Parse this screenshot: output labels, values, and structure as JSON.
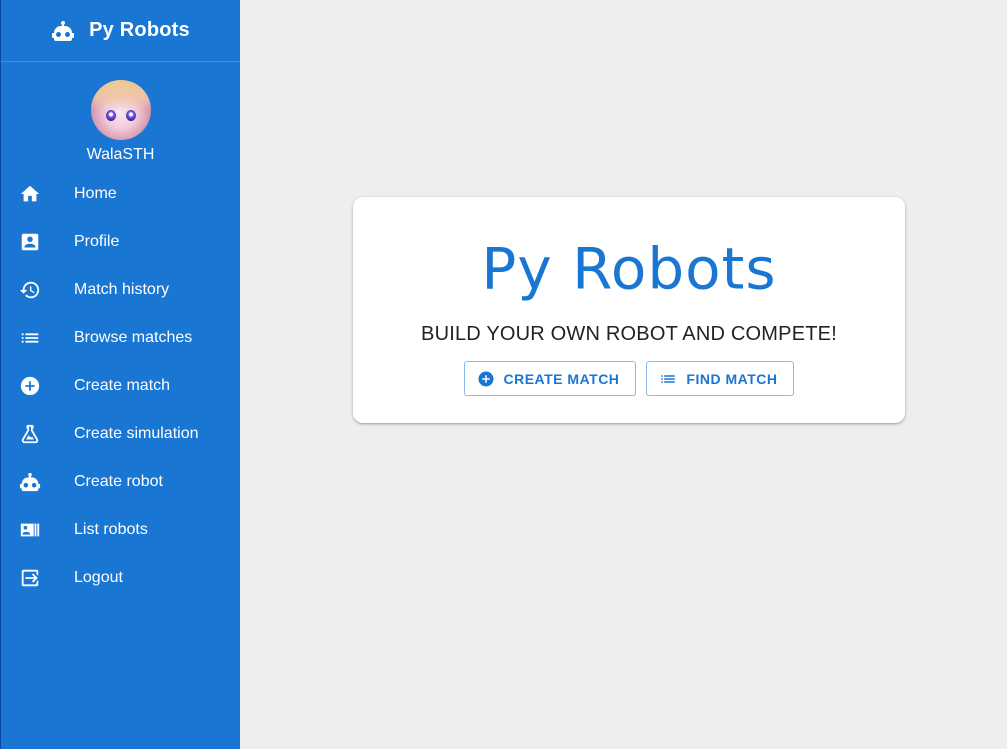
{
  "app": {
    "title": "Py Robots"
  },
  "user": {
    "name": "WalaSTH"
  },
  "sidebar": {
    "items": [
      {
        "label": "Home",
        "icon": "home-icon"
      },
      {
        "label": "Profile",
        "icon": "profile-icon"
      },
      {
        "label": "Match history",
        "icon": "history-icon"
      },
      {
        "label": "Browse matches",
        "icon": "list-icon"
      },
      {
        "label": "Create match",
        "icon": "add-circle-icon"
      },
      {
        "label": "Create simulation",
        "icon": "flask-icon"
      },
      {
        "label": "Create robot",
        "icon": "robot-icon"
      },
      {
        "label": "List robots",
        "icon": "badge-list-icon"
      },
      {
        "label": "Logout",
        "icon": "logout-icon"
      }
    ]
  },
  "main": {
    "title": "Py Robots",
    "subtitle": "BUILD YOUR OWN ROBOT AND COMPETE!",
    "create_match_label": "CREATE MATCH",
    "find_match_label": "FIND MATCH"
  },
  "colors": {
    "primary": "#1976d2",
    "background": "#eeeeee"
  }
}
